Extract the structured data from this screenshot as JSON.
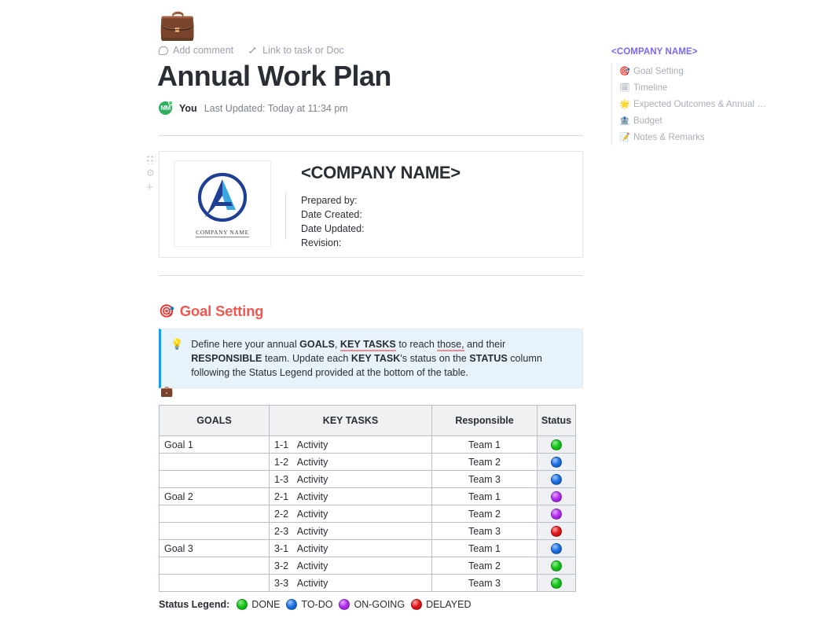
{
  "document": {
    "emoji": "briefcase",
    "title": "Annual Work Plan",
    "actions": [
      {
        "label": "Add comment",
        "icon": "comment-icon"
      },
      {
        "label": "Link to task or Doc",
        "icon": "link-icon"
      }
    ],
    "byline": {
      "avatar_initials": "MM",
      "author": "You",
      "updated": "Last Updated: Today at 11:34 pm"
    }
  },
  "card": {
    "logo_caption": "COMPANY NAME",
    "company_name": "<COMPANY NAME>",
    "fields": [
      "Prepared by:",
      "Date Created:",
      "Date Updated:",
      "Revision:"
    ]
  },
  "section": {
    "emoji": "dart",
    "heading": "Goal Setting",
    "heading_color": "#f4574f"
  },
  "callout": {
    "emoji": "light-bulb",
    "accent_color": "#1a9cf0",
    "background_color": "#e8f2fb",
    "line1_a": "Define here your annual ",
    "line1_b": "GOALS",
    "line1_c": ", ",
    "line1_d": "KEY TASKS",
    "line1_e": " to reach ",
    "line1_f": "those,",
    "line1_g": " and their ",
    "line1_h": "RESPONSIBLE",
    "line2_a": " team. Update each ",
    "line2_b": "KEY TASK",
    "line2_c": "'s status on the ",
    "line2_d": "STATUS",
    "line2_e": " column following the Status Legend provided at the bottom of the table."
  },
  "table": {
    "emoji": "briefcase",
    "headers": [
      "GOALS",
      "KEY TASKS",
      "Responsible",
      "Status"
    ],
    "rows": [
      {
        "goal": "Goal 1",
        "task_no": "1-1",
        "task": "Activity",
        "responsible": "Team 1",
        "status": "green"
      },
      {
        "goal": "",
        "task_no": "1-2",
        "task": "Activity",
        "responsible": "Team 2",
        "status": "blue"
      },
      {
        "goal": "",
        "task_no": "1-3",
        "task": "Activity",
        "responsible": "Team 3",
        "status": "blue"
      },
      {
        "goal": "Goal 2",
        "task_no": "2-1",
        "task": "Activity",
        "responsible": "Team 1",
        "status": "purple"
      },
      {
        "goal": "",
        "task_no": "2-2",
        "task": "Activity",
        "responsible": "Team 2",
        "status": "purple"
      },
      {
        "goal": "",
        "task_no": "2-3",
        "task": "Activity",
        "responsible": "Team 3",
        "status": "red"
      },
      {
        "goal": "Goal 3",
        "task_no": "3-1",
        "task": "Activity",
        "responsible": "Team 1",
        "status": "blue"
      },
      {
        "goal": "",
        "task_no": "3-2",
        "task": "Activity",
        "responsible": "Team 2",
        "status": "green"
      },
      {
        "goal": "",
        "task_no": "3-3",
        "task": "Activity",
        "responsible": "Team 3",
        "status": "green"
      }
    ]
  },
  "legend": {
    "label": "Status Legend:",
    "items": [
      {
        "color": "green",
        "label": "DONE"
      },
      {
        "color": "blue",
        "label": "TO-DO"
      },
      {
        "color": "purple",
        "label": "ON-GOING"
      },
      {
        "color": "red",
        "label": "DELAYED"
      }
    ]
  },
  "toc": {
    "title": "<COMPANY NAME>",
    "title_color": "#7b68ee",
    "items": [
      {
        "emoji": "dart",
        "label": "Goal Setting"
      },
      {
        "emoji": "calendar",
        "label": "Timeline"
      },
      {
        "emoji": "glowing-star",
        "label": "Expected Outcomes & Annual …"
      },
      {
        "emoji": "money-bag",
        "label": "Budget"
      },
      {
        "emoji": "memo",
        "label": "Notes & Remarks"
      }
    ]
  },
  "gutter": {
    "drag_handle": "drag-handle-icon",
    "settings": "gear-icon",
    "add": "plus-icon"
  }
}
